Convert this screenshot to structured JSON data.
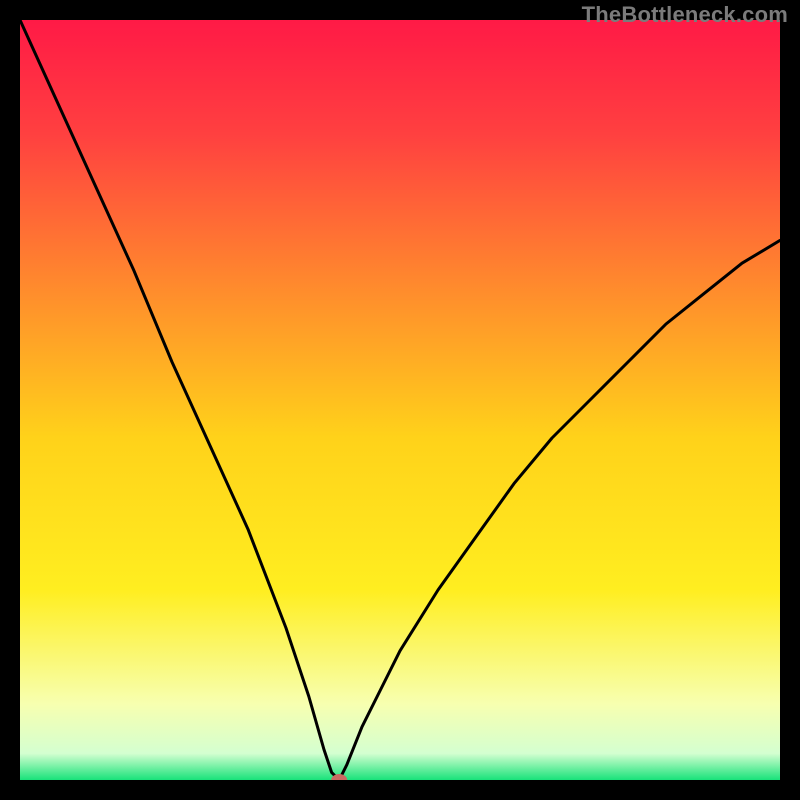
{
  "watermark": "TheBottleneck.com",
  "chart_data": {
    "type": "line",
    "x": [
      0,
      5,
      10,
      15,
      20,
      25,
      30,
      35,
      38,
      40,
      41,
      42,
      43,
      45,
      50,
      55,
      60,
      65,
      70,
      75,
      80,
      85,
      90,
      95,
      100
    ],
    "y": [
      100,
      89,
      78,
      67,
      55,
      44,
      33,
      20,
      11,
      4,
      1,
      0,
      2,
      7,
      17,
      25,
      32,
      39,
      45,
      50,
      55,
      60,
      64,
      68,
      71
    ],
    "xlim": [
      0,
      100
    ],
    "ylim": [
      0,
      100
    ],
    "marker": {
      "x": 42,
      "y": 0
    },
    "background": {
      "type": "vertical-gradient",
      "stops": [
        {
          "pos": 0.0,
          "color": "#ff1a46"
        },
        {
          "pos": 0.15,
          "color": "#ff4040"
        },
        {
          "pos": 0.35,
          "color": "#ff8a2d"
        },
        {
          "pos": 0.55,
          "color": "#ffd21a"
        },
        {
          "pos": 0.75,
          "color": "#ffee20"
        },
        {
          "pos": 0.9,
          "color": "#f7ffb0"
        },
        {
          "pos": 0.965,
          "color": "#d4ffd0"
        },
        {
          "pos": 1.0,
          "color": "#18e27a"
        }
      ]
    },
    "title": "",
    "xlabel": "",
    "ylabel": ""
  }
}
